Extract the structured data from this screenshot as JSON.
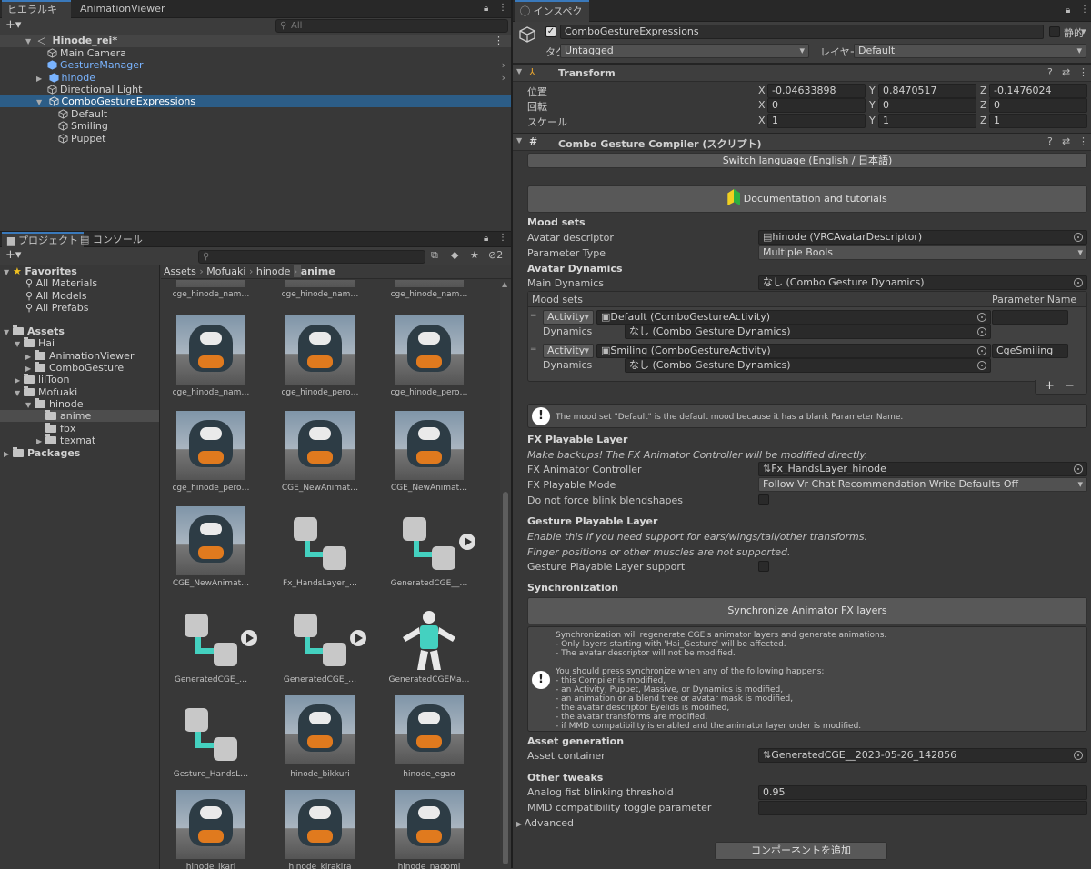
{
  "hierarchy": {
    "tabs": [
      "ヒエラルキー",
      "AnimationViewer"
    ],
    "search_placeholder": "All",
    "scene": "Hinode_rei*",
    "items": [
      {
        "label": "Main Camera",
        "color": "normal"
      },
      {
        "label": "GestureManager",
        "color": "blue"
      },
      {
        "label": "hinode",
        "color": "blue"
      },
      {
        "label": "Directional Light",
        "color": "normal"
      },
      {
        "label": "ComboGestureExpressions",
        "color": "normal"
      },
      {
        "label": "Default",
        "color": "normal"
      },
      {
        "label": "Smiling",
        "color": "normal"
      },
      {
        "label": "Puppet",
        "color": "normal"
      }
    ]
  },
  "project": {
    "tabs": [
      "プロジェクト",
      "コンソール"
    ],
    "hidden_count": "2",
    "favorites": {
      "title": "Favorites",
      "items": [
        "All Materials",
        "All Models",
        "All Prefabs"
      ]
    },
    "assets": {
      "title": "Assets",
      "items": [
        "Hai",
        "AnimationViewer",
        "ComboGesture",
        "lilToon",
        "Mofuaki",
        "hinode",
        "anime",
        "fbx",
        "texmat"
      ]
    },
    "packages": "Packages",
    "breadcrumb": [
      "Assets",
      "Mofuaki",
      "hinode",
      "anime"
    ],
    "grid": [
      "cge_hinode_nam…",
      "cge_hinode_nam…",
      "cge_hinode_nam…",
      "cge_hinode_nam…",
      "cge_hinode_pero…",
      "cge_hinode_pero…",
      "cge_hinode_pero…",
      "CGE_NewAnimat…",
      "CGE_NewAnimat…",
      "CGE_NewAnimat…",
      "Fx_HandsLayer_…",
      "GeneratedCGE__…",
      "GeneratedCGE_…",
      "GeneratedCGE_…",
      "GeneratedCGEMa…",
      "Gesture_HandsL…",
      "hinode_bikkuri",
      "hinode_egao",
      "hinode_ikari",
      "hinode_kirakira",
      "hinode_nagomi"
    ]
  },
  "inspector": {
    "tab": "インスペクター",
    "object_name": "ComboGestureExpressions",
    "static_label": "静的",
    "tag_label": "タグ",
    "tag_value": "Untagged",
    "layer_label": "レイヤー",
    "layer_value": "Default",
    "transform": {
      "title": "Transform",
      "position_label": "位置",
      "position": [
        "-0.04633898",
        "0.8470517",
        "-0.1476024"
      ],
      "rotation_label": "回転",
      "rotation": [
        "0",
        "0",
        "0"
      ],
      "scale_label": "スケール",
      "scale": [
        "1",
        "1",
        "1"
      ]
    },
    "cgc": {
      "title": "Combo Gesture Compiler (スクリプト)",
      "switch_language": "Switch language (English / 日本語)",
      "documentation": "Documentation and tutorials",
      "mood_sets_header": "Mood sets",
      "avatar_descriptor_label": "Avatar descriptor",
      "avatar_descriptor_value": "hinode (VRCAvatarDescriptor)",
      "parameter_type_label": "Parameter Type",
      "parameter_type_value": "Multiple Bools",
      "avatar_dynamics_header": "Avatar Dynamics",
      "main_dynamics_label": "Main Dynamics",
      "main_dynamics_value": "なし (Combo Gesture Dynamics)",
      "list_header": "Mood sets",
      "list_param_header": "Parameter Name",
      "entries": [
        {
          "kind": "Activity",
          "activity": "Default (ComboGestureActivity)",
          "dynamics_label": "Dynamics",
          "dynamics": "なし (Combo Gesture Dynamics)",
          "param": ""
        },
        {
          "kind": "Activity",
          "activity": "Smiling (ComboGestureActivity)",
          "dynamics_label": "Dynamics",
          "dynamics": "なし (Combo Gesture Dynamics)",
          "param": "CgeSmiling"
        }
      ],
      "default_info": "The mood set \"Default\" is the default mood because it has a blank Parameter Name.",
      "fx_header": "FX Playable Layer",
      "fx_warning": "Make backups! The FX Animator Controller will be modified directly.",
      "fx_controller_label": "FX Animator Controller",
      "fx_controller_value": "Fx_HandsLayer_hinode",
      "fx_mode_label": "FX Playable Mode",
      "fx_mode_value": "Follow Vr Chat Recommendation Write Defaults Off",
      "no_blink_label": "Do not force blink blendshapes",
      "gesture_header": "Gesture Playable Layer",
      "gesture_note1": "Enable this if you need support for ears/wings/tail/other transforms.",
      "gesture_note2": "Finger positions or other muscles are not supported.",
      "gesture_support_label": "Gesture Playable Layer support",
      "sync_header": "Synchronization",
      "sync_button": "Synchronize Animator FX layers",
      "sync_info": "Synchronization will regenerate CGE's animator layers and generate animations.\n- Only layers starting with 'Hai_Gesture' will be affected.\n- The avatar descriptor will not be modified.\n\nYou should press synchronize when any of the following happens:\n- this Compiler is modified,\n- an Activity, Puppet, Massive, or Dynamics is modified,\n- an animation or a blend tree or avatar mask is modified,\n- the avatar descriptor Eyelids is modified,\n- the avatar transforms are modified,\n- if MMD compatibility is enabled and the animator layer order is modified.",
      "asset_header": "Asset generation",
      "asset_container_label": "Asset container",
      "asset_container_value": "GeneratedCGE__2023-05-26_142856",
      "tweaks_header": "Other tweaks",
      "blink_threshold_label": "Analog fist blinking threshold",
      "blink_threshold_value": "0.95",
      "mmd_label": "MMD compatibility toggle parameter",
      "mmd_value": "",
      "advanced": "Advanced"
    },
    "add_component": "コンポーネントを追加"
  }
}
